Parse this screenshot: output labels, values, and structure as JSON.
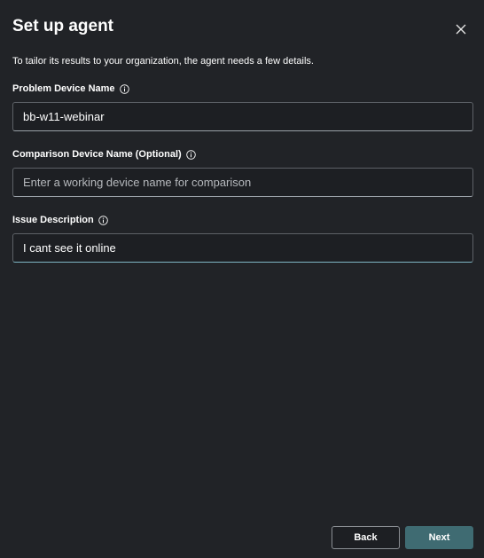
{
  "dialog": {
    "title": "Set up agent",
    "subtitle": "To tailor its results to your organization, the agent needs a few details."
  },
  "fields": [
    {
      "label": "Problem Device Name",
      "value": "bb-w11-webinar",
      "placeholder": "",
      "info_icon": "info-icon"
    },
    {
      "label": "Comparison Device Name (Optional)",
      "value": "",
      "placeholder": "Enter a working device name for comparison",
      "info_icon": "info-icon"
    },
    {
      "label": "Issue Description",
      "value": "I cant see it online",
      "placeholder": "",
      "info_icon": "info-icon"
    }
  ],
  "footer": {
    "back_label": "Back",
    "next_label": "Next"
  },
  "colors": {
    "background": "#212327",
    "primary_button": "#3f6b72",
    "focus_underline": "#7fb6c4"
  }
}
